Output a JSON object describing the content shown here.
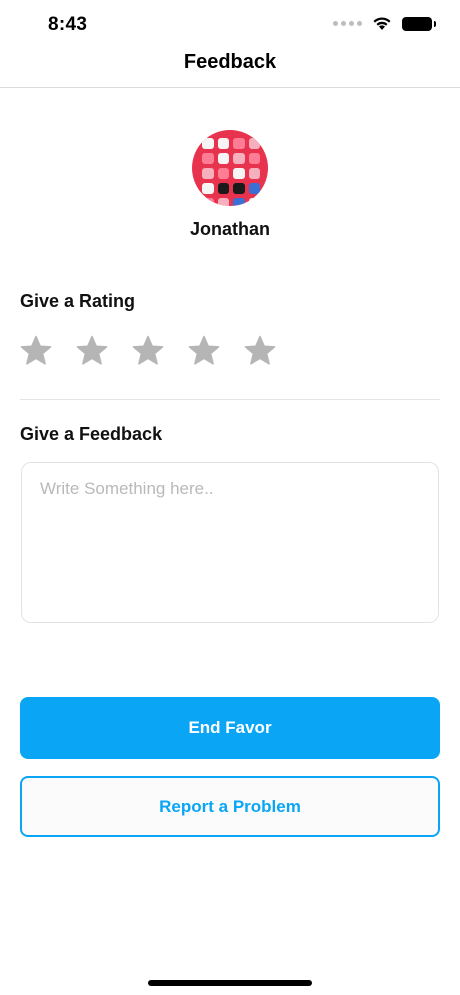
{
  "status_bar": {
    "time": "8:43"
  },
  "nav": {
    "title": "Feedback"
  },
  "profile": {
    "name": "Jonathan"
  },
  "rating": {
    "label": "Give a Rating",
    "max_stars": 5,
    "value": 0
  },
  "feedback": {
    "label": "Give a Feedback",
    "placeholder": "Write Something here..",
    "value": ""
  },
  "actions": {
    "primary_label": "End Favor",
    "secondary_label": "Report a Problem"
  },
  "colors": {
    "accent": "#0aa6f5",
    "star_inactive": "#b5b5b5"
  },
  "icons": {
    "star": "star-icon",
    "wifi": "wifi-icon",
    "battery": "battery-icon"
  }
}
